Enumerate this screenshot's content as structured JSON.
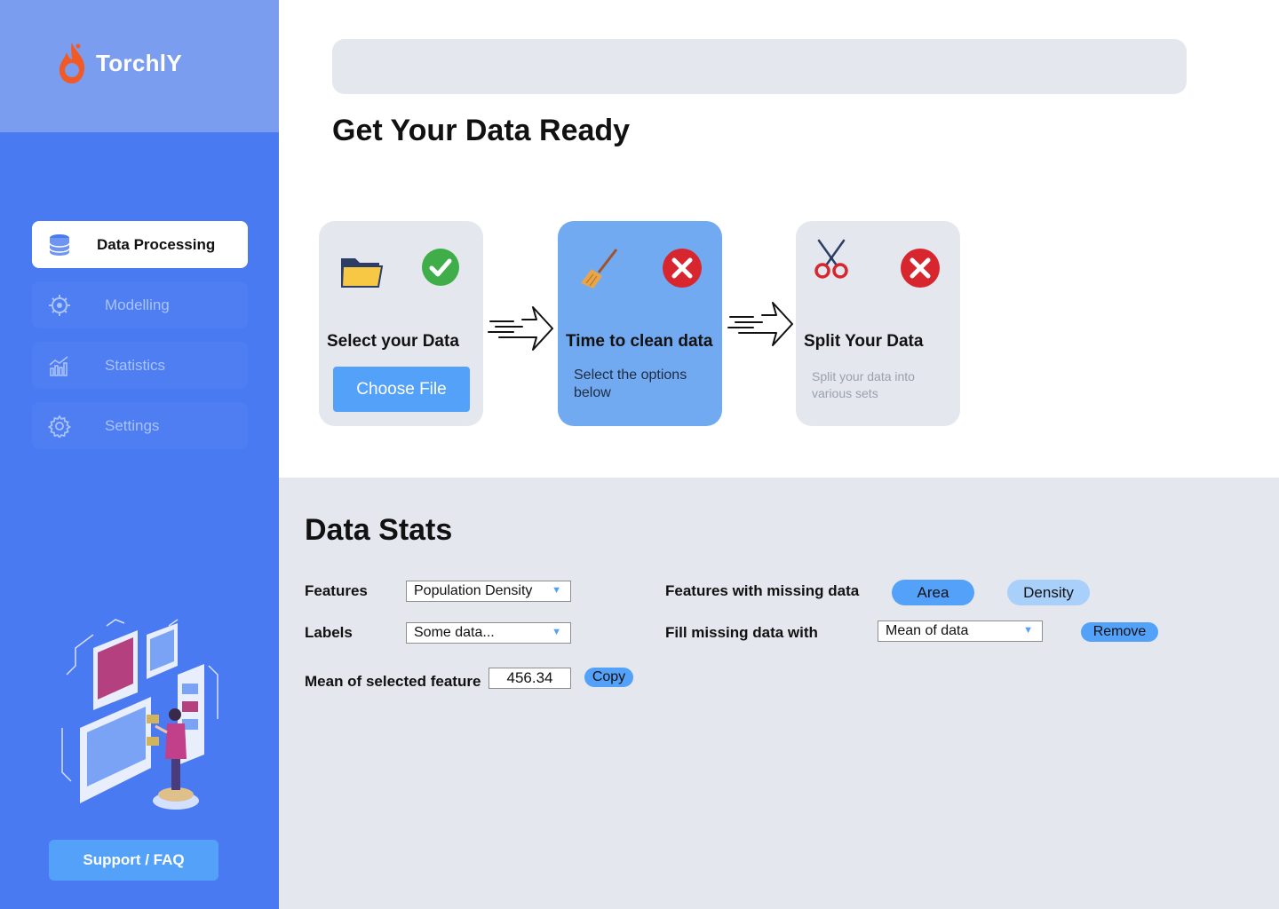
{
  "app": {
    "name": "TorchlY"
  },
  "sidebar": {
    "items": [
      {
        "label": "Data Processing",
        "icon": "database-icon",
        "active": true
      },
      {
        "label": "Modelling",
        "icon": "brain-chip-icon",
        "active": false
      },
      {
        "label": "Statistics",
        "icon": "bar-chart-icon",
        "active": false
      },
      {
        "label": "Settings",
        "icon": "gear-icon",
        "active": false
      }
    ],
    "support_label": "Support / FAQ"
  },
  "header": {
    "search": {
      "value": "",
      "placeholder": ""
    },
    "title": "Get Your Data Ready"
  },
  "steps": [
    {
      "title": "Select your Data",
      "icon": "folder-icon",
      "status": "done",
      "button_label": "Choose File"
    },
    {
      "title": "Time to clean data",
      "icon": "broom-icon",
      "status": "pending",
      "description": "Select the options below"
    },
    {
      "title": "Split Your Data",
      "icon": "scissors-icon",
      "status": "pending",
      "description": "Split your data into various sets"
    }
  ],
  "stats": {
    "title": "Data Stats",
    "features_label": "Features",
    "features_value": "Population Density",
    "labels_label": "Labels",
    "labels_value": "Some data...",
    "mean_label": "Mean of selected feature",
    "mean_value": "456.34",
    "copy_label": "Copy",
    "missing_label": "Features with missing data",
    "missing_features": [
      "Area",
      "Density"
    ],
    "fill_label": "Fill missing data with",
    "fill_value": "Mean of data",
    "remove_label": "Remove"
  },
  "colors": {
    "sidebar": "#4a7af1",
    "sidebar_header": "#7a9df0",
    "accent": "#54a1f9",
    "success": "#3fae49",
    "error": "#d8262e",
    "panel": "#e4e7ee"
  }
}
